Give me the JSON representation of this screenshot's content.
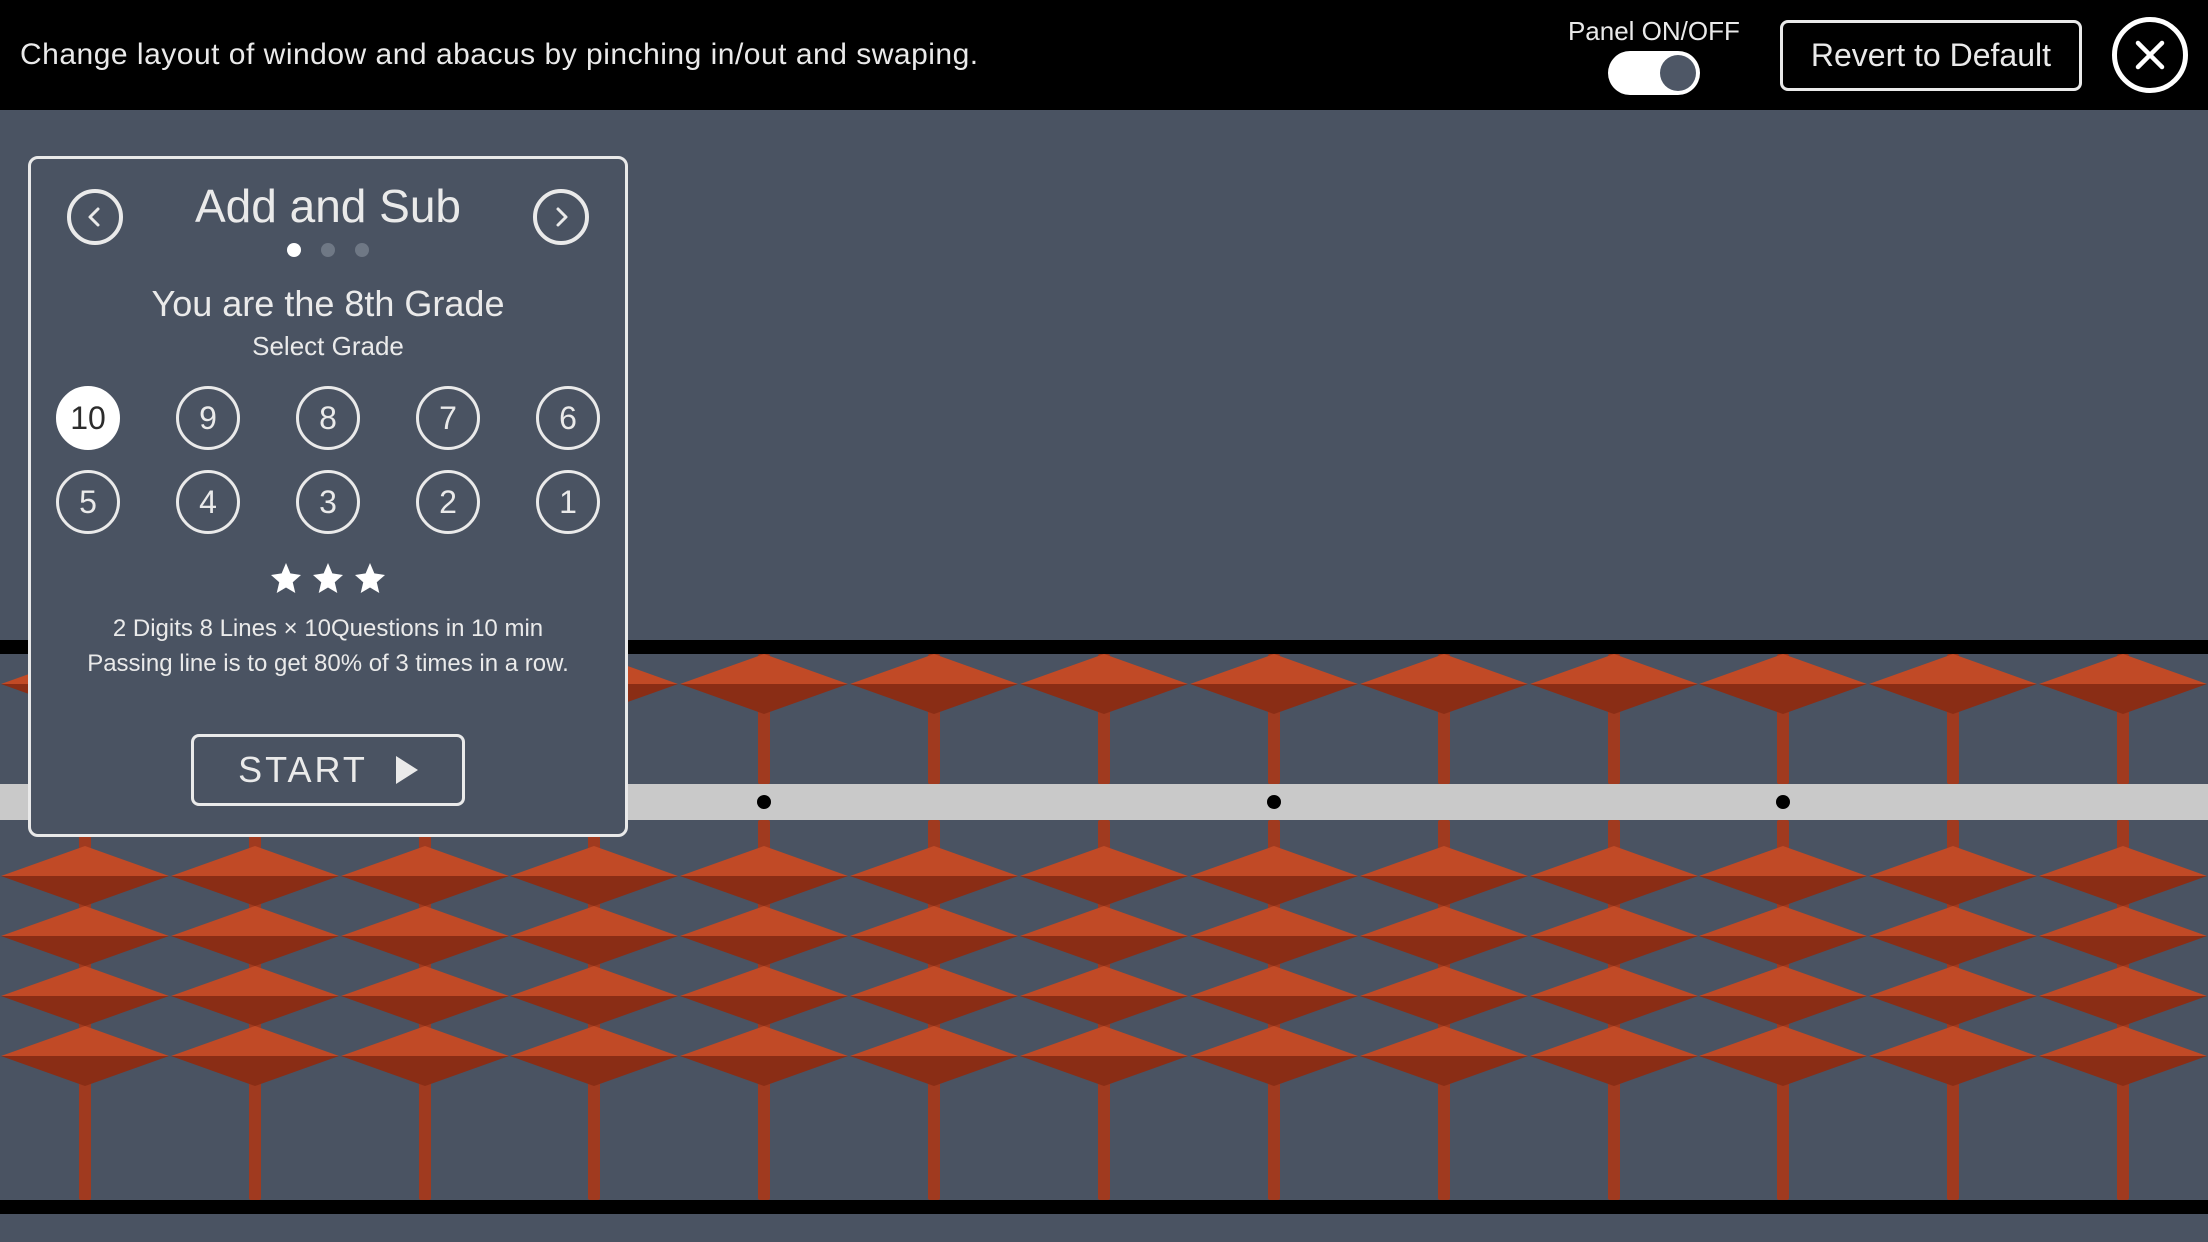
{
  "topbar": {
    "hint": "Change layout of window and abacus by pinching in/out and swaping.",
    "panel_toggle_label": "Panel ON/OFF",
    "panel_on": true,
    "revert_label": "Revert to Default"
  },
  "panel": {
    "title": "Add and Sub",
    "page_index": 0,
    "page_count": 3,
    "grade_line": "You are the 8th Grade",
    "select_grade_label": "Select  Grade",
    "grades": [
      "10",
      "9",
      "8",
      "7",
      "6",
      "5",
      "4",
      "3",
      "2",
      "1"
    ],
    "selected_grade": "10",
    "stars": 3,
    "desc_line1": "2 Digits  8 Lines ×  10Questions  in  10 min",
    "desc_line2": "Passing line is to get 80% of 3 times in a row.",
    "start_label": "START"
  },
  "abacus": {
    "columns": 13,
    "marker_every": 3
  },
  "colors": {
    "bg": "#4a5362",
    "bead_top": "#c14a26",
    "bead_bottom": "#8a2d15",
    "rod": "#a03a1f",
    "bar": "#c9c9c9"
  }
}
